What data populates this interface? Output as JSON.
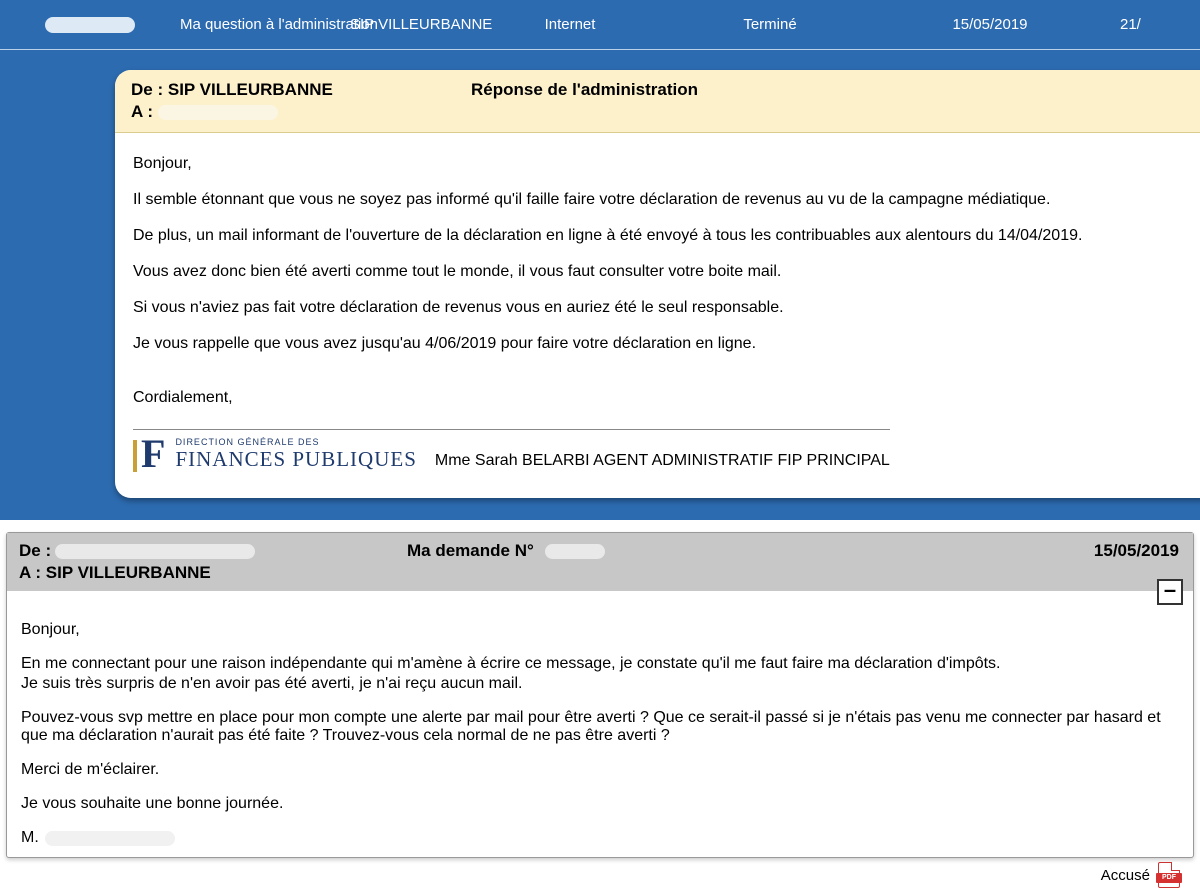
{
  "topbar": {
    "question": "Ma question à l'administration",
    "sip": "SIP VILLEURBANNE",
    "channel": "Internet",
    "status": "Terminé",
    "date": "15/05/2019",
    "tail": "21/"
  },
  "reply": {
    "from_label": "De :",
    "from_value": "SIP VILLEURBANNE",
    "to_label": "A :",
    "title": "Réponse de l'administration",
    "body": {
      "greet": "Bonjour,",
      "p1": "Il semble étonnant que vous ne soyez pas informé qu'il faille faire votre déclaration de revenus au vu de la campagne médiatique.",
      "p2": "De plus, un mail informant de l'ouverture de la déclaration en ligne à été envoyé à tous les contribuables aux alentours du 14/04/2019.",
      "p3": "Vous avez donc bien été averti comme tout le monde, il vous faut consulter votre boite mail.",
      "p4": "Si vous n'aviez pas fait votre déclaration de revenus vous en auriez été le seul responsable.",
      "p5": "Je vous rappelle que vous avez jusqu'au 4/06/2019 pour faire votre déclaration en ligne.",
      "closing": "Cordialement,"
    },
    "logo_small": "DIRECTION GÉNÉRALE DES",
    "logo_big": "FINANCES PUBLIQUES",
    "agent": "Mme Sarah BELARBI AGENT ADMINISTRATIF FIP PRINCIPAL"
  },
  "request": {
    "from_label": "De :",
    "to_label": "A :",
    "to_value": "SIP VILLEURBANNE",
    "mid_label": "Ma demande N°",
    "date": "15/05/2019",
    "collapse_glyph": "–",
    "body": {
      "greet": "Bonjour,",
      "p1": "En me connectant pour une raison indépendante qui m'amène à écrire ce message, je constate qu'il me faut faire ma déclaration d'impôts.",
      "p1b": "Je suis très surpris de n'en avoir pas été averti, je n'ai reçu aucun mail.",
      "p2": "Pouvez-vous svp mettre en place pour mon compte une alerte par mail pour être averti ? Que ce serait-il passé si je n'étais pas venu me connecter par hasard et que ma déclaration n'aurait pas été faite ? Trouvez-vous cela normal de ne pas être averti ?",
      "p3": "Merci de m'éclairer.",
      "p4": "Je vous souhaite une bonne journée.",
      "sig": "M."
    }
  },
  "footer": {
    "accuse": "Accusé",
    "pdf": "PDF"
  }
}
